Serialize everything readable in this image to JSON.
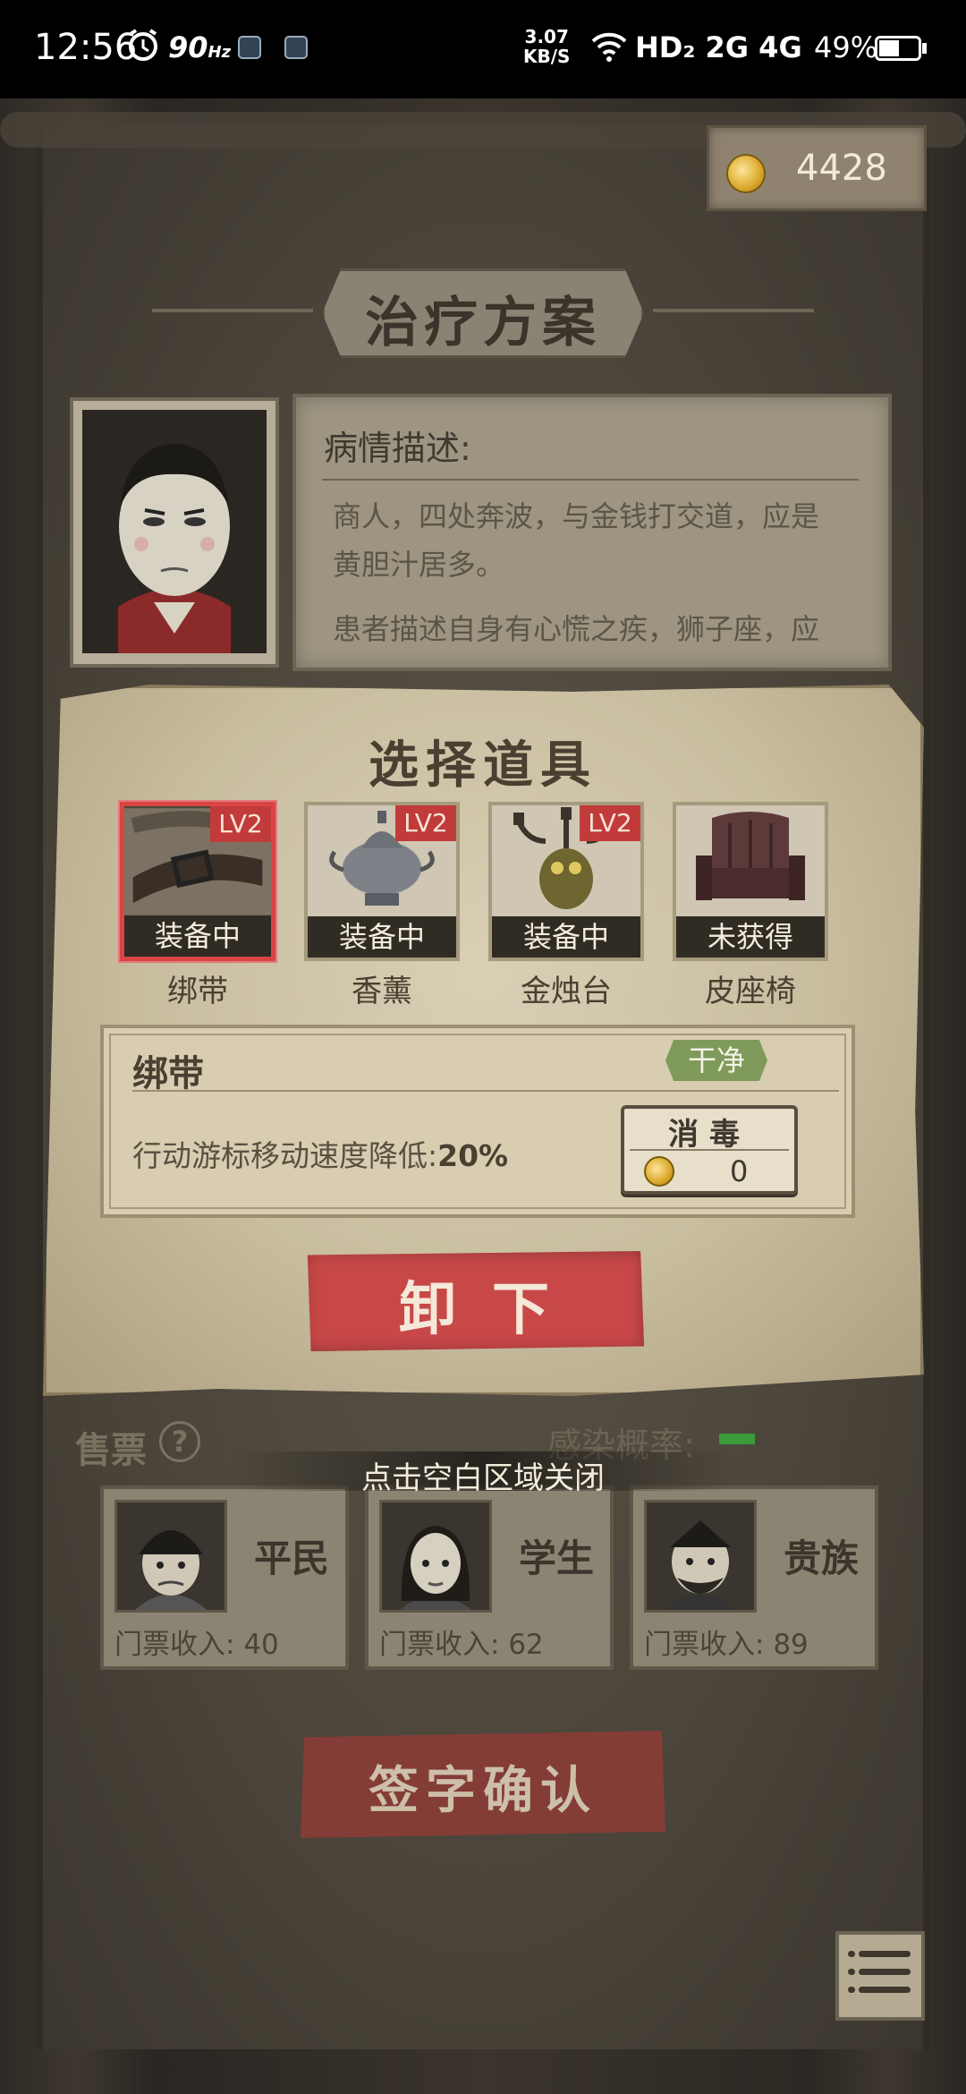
{
  "status_bar": {
    "time": "12:56",
    "refresh_rate": "90",
    "refresh_unit": "Hz",
    "net_speed_value": "3.07",
    "net_speed_unit": "KB/S",
    "network": "HD₂ 2G 4G",
    "battery": "49%"
  },
  "coins": {
    "amount": "4428"
  },
  "treatment": {
    "title": "治疗方案",
    "description_title": "病情描述:",
    "description_lines": [
      "商人，四处奔波，与金钱打交道，应是",
      "黄胆汁居多。",
      "患者描述自身有心慌之疾，狮子座，应"
    ]
  },
  "modal": {
    "title": "选择道具",
    "items": [
      {
        "name": "绑带",
        "status": "装备中",
        "level": "LV2",
        "selected": true
      },
      {
        "name": "香薰",
        "status": "装备中",
        "level": "LV2",
        "selected": false
      },
      {
        "name": "金烛台",
        "status": "装备中",
        "level": "LV2",
        "selected": false
      },
      {
        "name": "皮座椅",
        "status": "未获得",
        "level": "",
        "selected": false
      }
    ],
    "detail": {
      "name": "绑带",
      "tag": "干净",
      "effect_text": "行动游标移动速度降低:",
      "effect_value": "20%",
      "disinfect_label": "消毒",
      "disinfect_cost": "0"
    },
    "unequip_label": "卸下"
  },
  "close_hint": "点击空白区域关闭",
  "tickets": {
    "label": "售票",
    "help_icon": "?",
    "infection_label": "感染概率:",
    "visitors": [
      {
        "name": "平民",
        "income_label": "门票收入:",
        "income": "40"
      },
      {
        "name": "学生",
        "income_label": "门票收入:",
        "income": "62"
      },
      {
        "name": "贵族",
        "income_label": "门票收入:",
        "income": "89"
      }
    ]
  },
  "sign_label": "签字确认",
  "colors": {
    "accent_red": "#c84848",
    "selected_border": "#d94444",
    "tag_green": "#7f9a5a",
    "infection_green": "#3c9a3c"
  },
  "icons": [
    "alarm-icon",
    "wifi-icon",
    "signal-icon",
    "battery-icon",
    "coin-icon",
    "help-icon",
    "menu-icon"
  ]
}
